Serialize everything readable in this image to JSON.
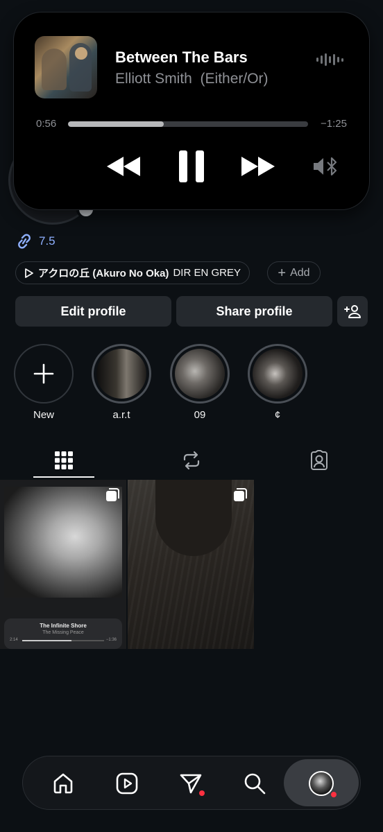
{
  "now_playing": {
    "title": "Between The Bars",
    "subtitle": "Elliott Smith  (Either/Or)",
    "elapsed": "0:56",
    "remaining": "−1:25",
    "progress": 0.4,
    "icons": [
      "waveform-icon",
      "rewind-icon",
      "pause-icon",
      "fast-forward-icon",
      "bluetooth-speaker-icon"
    ]
  },
  "profile": {
    "link_text": "7.5",
    "music_song": "アクロの丘 (Akuro No Oka)",
    "music_artist": "DIR EN GREY",
    "add_label": "Add"
  },
  "actions": {
    "edit_label": "Edit profile",
    "share_label": "Share profile"
  },
  "highlights": [
    {
      "label": "New"
    },
    {
      "label": "a.r.t"
    },
    {
      "label": "09"
    },
    {
      "label": "¢"
    }
  ],
  "tabs": [
    {
      "name": "grid",
      "active": true
    },
    {
      "name": "reposts",
      "active": false
    },
    {
      "name": "tagged",
      "active": false
    }
  ],
  "posts": [
    {
      "mini_title": "The Infinite Shore",
      "mini_subtitle": "The Missing Peace",
      "mini_elapsed": "2:14",
      "mini_remaining": "−1:36"
    },
    {}
  ],
  "nav": {
    "items": [
      "home",
      "reels",
      "messages",
      "search",
      "profile"
    ],
    "accent": "#ff3040"
  }
}
